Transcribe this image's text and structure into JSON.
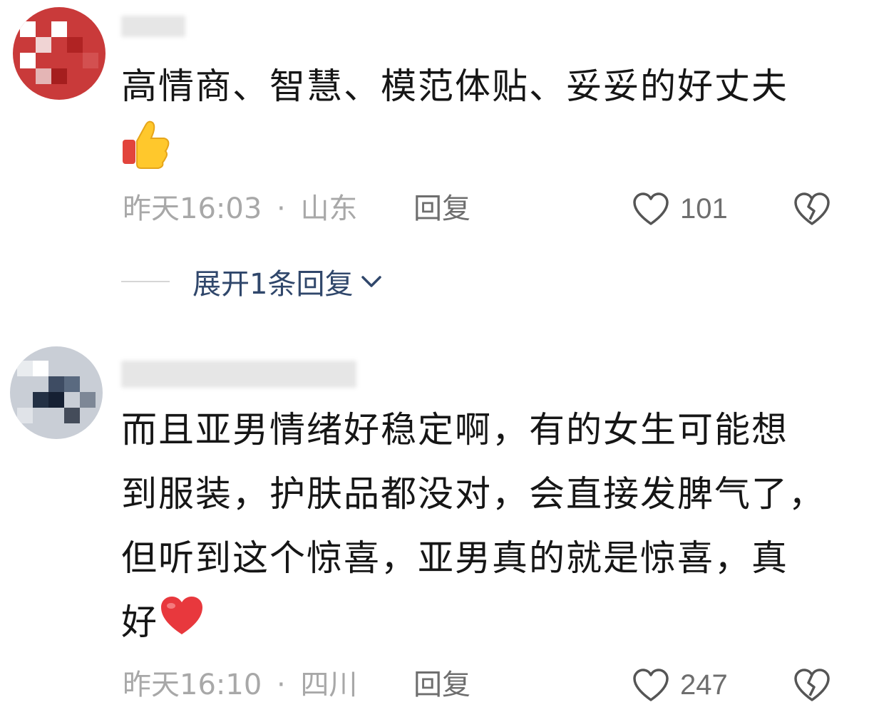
{
  "comments": [
    {
      "text": "高情商、智慧、模范体贴、妥妥的好丈夫",
      "time": "昨天16:03",
      "sep": "·",
      "location": "山东",
      "reply_label": "回复",
      "likes": "101",
      "emoji": "thumbs-up-icon"
    },
    {
      "line1": "而且亚男情绪好稳定啊，有的女生可能想",
      "line2": "到服装，护肤品都没对，会直接发脾气了，",
      "line3": "但听到这个惊喜，亚男真的就是惊喜，真",
      "line4": "好",
      "time": "昨天16:10",
      "sep": "·",
      "location": "四川",
      "reply_label": "回复",
      "likes": "247",
      "emoji": "red-heart-icon"
    }
  ],
  "expand_replies": {
    "label": "展开1条回复"
  },
  "colors": {
    "meta": "#a8a8a8",
    "link": "#30476b",
    "action": "#6e6e6e"
  }
}
